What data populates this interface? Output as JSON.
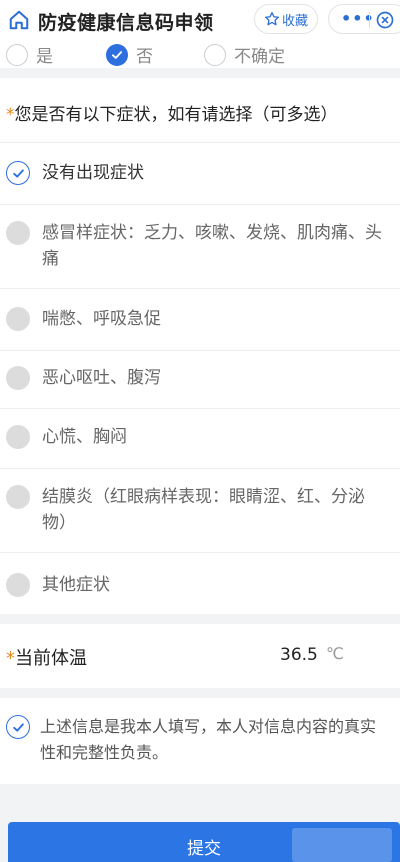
{
  "header": {
    "title": "防疫健康信息码申领",
    "favorite_label": "收藏",
    "more_glyph": "•••"
  },
  "radio_options": [
    {
      "label": "是",
      "checked": false
    },
    {
      "label": "否",
      "checked": true
    },
    {
      "label": "不确定",
      "checked": false
    }
  ],
  "symptoms": {
    "required_mark": "*",
    "question": "您是否有以下症状，如有请选择（可多选）",
    "options": [
      {
        "label": "没有出现症状",
        "checked": true
      },
      {
        "label": "感冒样症状：乏力、咳嗽、发烧、肌肉痛、头痛",
        "checked": false
      },
      {
        "label": "喘憋、呼吸急促",
        "checked": false
      },
      {
        "label": "恶心呕吐、腹泻",
        "checked": false
      },
      {
        "label": "心慌、胸闷",
        "checked": false
      },
      {
        "label": "结膜炎（红眼病样表现：眼睛涩、红、分泌物）",
        "checked": false
      },
      {
        "label": "其他症状",
        "checked": false
      }
    ]
  },
  "temperature": {
    "required_mark": "*",
    "label": "当前体温",
    "value": "36.5",
    "unit": "℃"
  },
  "declaration": {
    "text": "上述信息是我本人填写，本人对信息内容的真实性和完整性负责。",
    "checked": true
  },
  "submit": {
    "label": "提交"
  },
  "colors": {
    "accent": "#2b75e4",
    "required": "#e88a22"
  }
}
